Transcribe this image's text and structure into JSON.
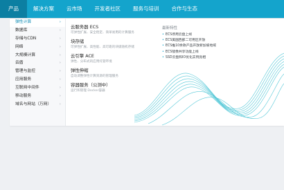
{
  "topnav": {
    "items": [
      "产品",
      "解决方案",
      "云市场",
      "开发者社区",
      "服务与培训",
      "合作与生态"
    ]
  },
  "sidebar": {
    "items": [
      "弹性计算",
      "数据库",
      "存储与CDN",
      "网络",
      "大规模计算",
      "云盾",
      "管理与监控",
      "应用服务",
      "互联网中间件",
      "移动服务",
      "域名与网站（万网）"
    ]
  },
  "products": [
    {
      "title": "云服务器 ECS",
      "desc": "可弹性扩展、安全稳定、简单易用的计算服务"
    },
    {
      "title": "块存储",
      "desc": "可弹性扩展、高性能、高可靠的块级随机存储"
    },
    {
      "title": "云引擎 ACE",
      "desc": "弹性、分布式的应用托管环境"
    },
    {
      "title": "弹性伸缩",
      "desc": "自动调整弹性计算资源的管理服务"
    },
    {
      "title": "容器服务（公测中）",
      "desc": "运行和管理 Docker容器"
    }
  ],
  "news": {
    "heading": "最新特性",
    "items": [
      "ECS停用云盘上线",
      "ECS美国西部二可用区开放",
      "ECS推10余款产品开放新加坡地域",
      "ECS镜像共享功能上线",
      "SSD云盘和IO优化实例亮相"
    ]
  },
  "colors": {
    "nav_bg": "#14a4cc",
    "nav_active": "#0c7fa2",
    "accent_text": "#0d8bb4",
    "page_bg": "#eef0f3",
    "wave": "#18b4c9"
  }
}
